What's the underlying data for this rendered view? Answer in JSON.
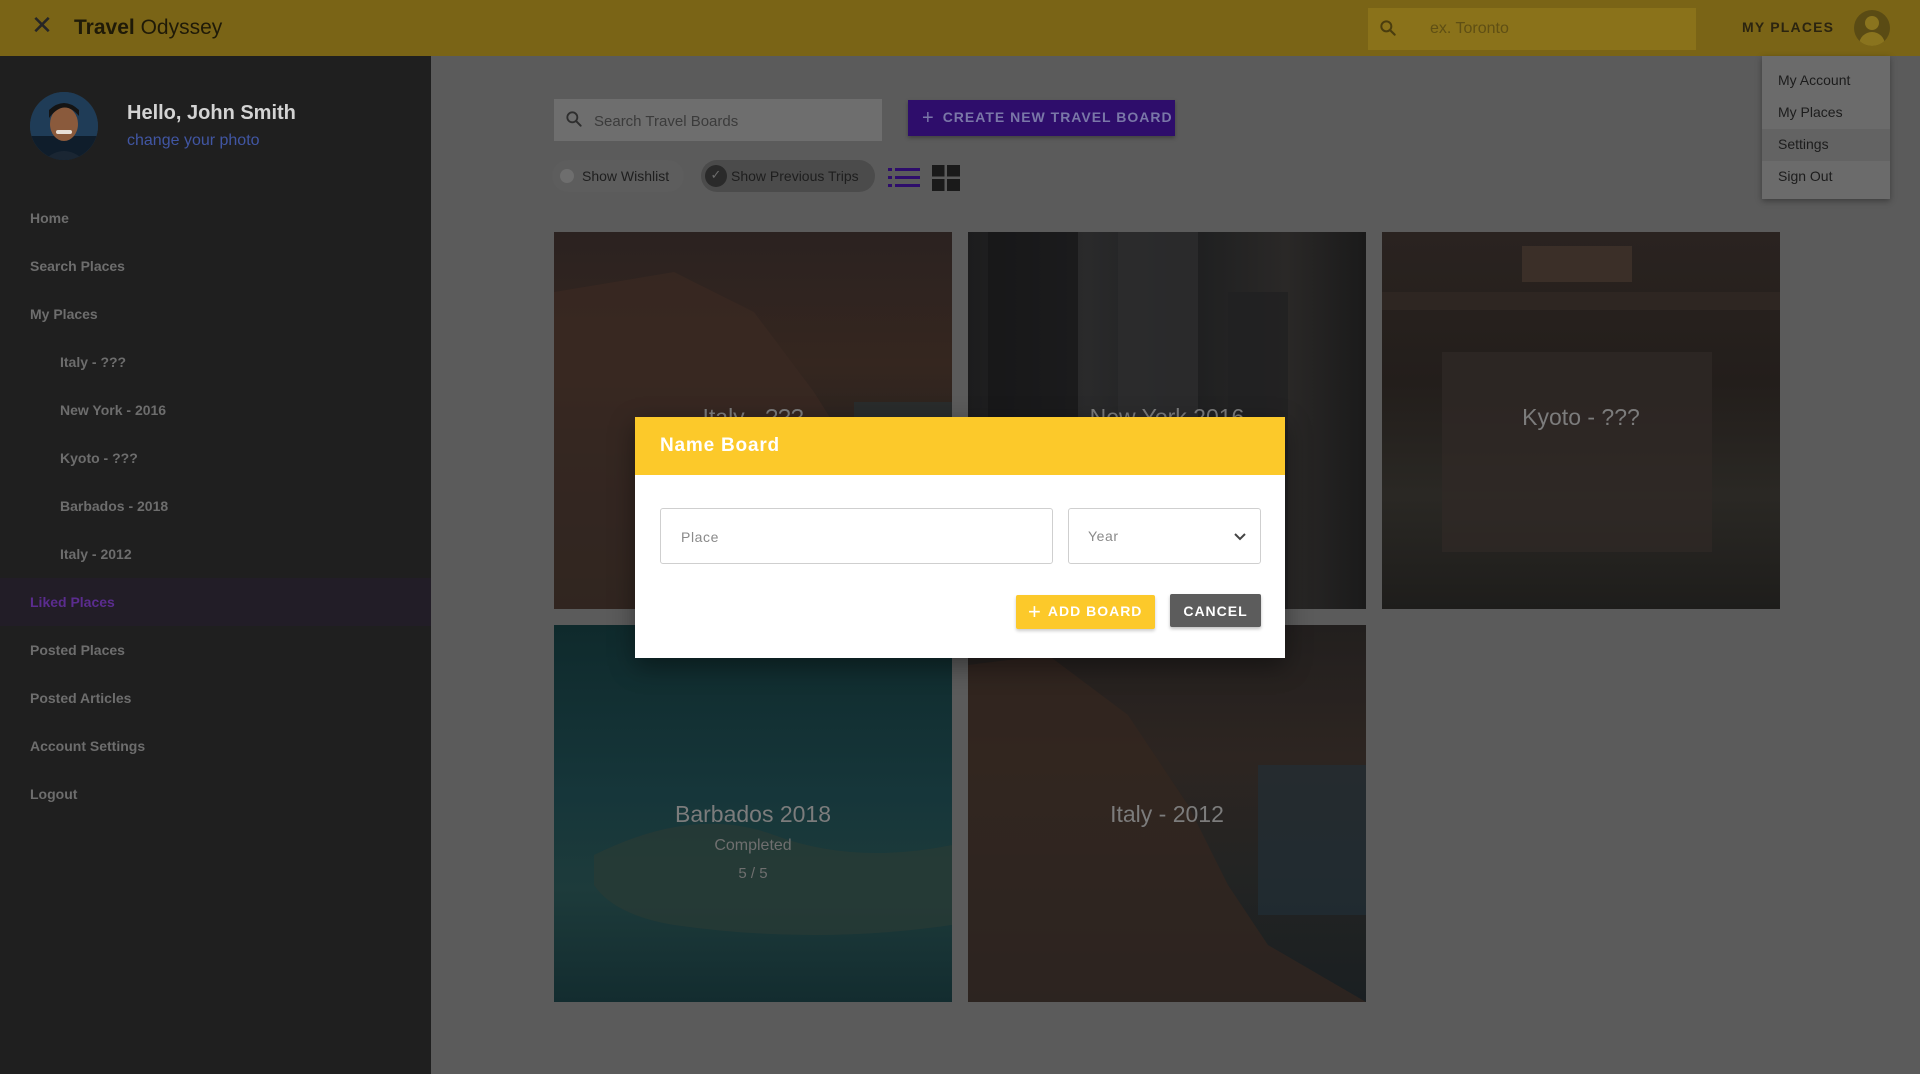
{
  "header": {
    "brand_bold": "Travel",
    "brand_light": "Odyssey",
    "search_placeholder": "ex. Toronto",
    "my_places_label": "MY PLACES"
  },
  "account_menu": {
    "items": [
      {
        "label": "My Account"
      },
      {
        "label": "My Places"
      },
      {
        "label": "Settings",
        "highlighted": true
      },
      {
        "label": "Sign Out"
      }
    ]
  },
  "sidebar": {
    "greeting": "Hello, John Smith",
    "change_photo": "change your photo",
    "items": [
      {
        "label": "Home"
      },
      {
        "label": "Search Places"
      },
      {
        "label": "My Places"
      },
      {
        "label": "Italy - ???",
        "sub": true
      },
      {
        "label": "New York - 2016",
        "sub": true
      },
      {
        "label": "Kyoto - ???",
        "sub": true
      },
      {
        "label": "Barbados - 2018",
        "sub": true
      },
      {
        "label": "Italy - 2012",
        "sub": true
      },
      {
        "label": "Liked Places",
        "active": true
      },
      {
        "label": "Posted Places"
      },
      {
        "label": "Posted Articles"
      },
      {
        "label": "Account Settings"
      },
      {
        "label": "Logout"
      }
    ]
  },
  "toolbar": {
    "search_placeholder": "Search Travel Boards",
    "create_label": "CREATE NEW TRAVEL BOARD",
    "chip_wishlist": "Show Wishlist",
    "chip_previous": "Show Previous Trips"
  },
  "boards": [
    {
      "title": "Italy - ???"
    },
    {
      "title": "New York 2016"
    },
    {
      "title": "Kyoto - ???"
    },
    {
      "title": "Barbados 2018",
      "status": "Completed",
      "progress": "5 / 5"
    },
    {
      "title": "Italy - 2012"
    }
  ],
  "dialog": {
    "title": "Name Board",
    "place_placeholder": "Place",
    "year_label": "Year",
    "add_label": "ADD BOARD",
    "cancel_label": "CANCEL"
  },
  "colors": {
    "primary_yellow": "#fcc92a",
    "accent_purple": "#5b1fd6",
    "sidebar_bg": "#1f1f1f"
  }
}
